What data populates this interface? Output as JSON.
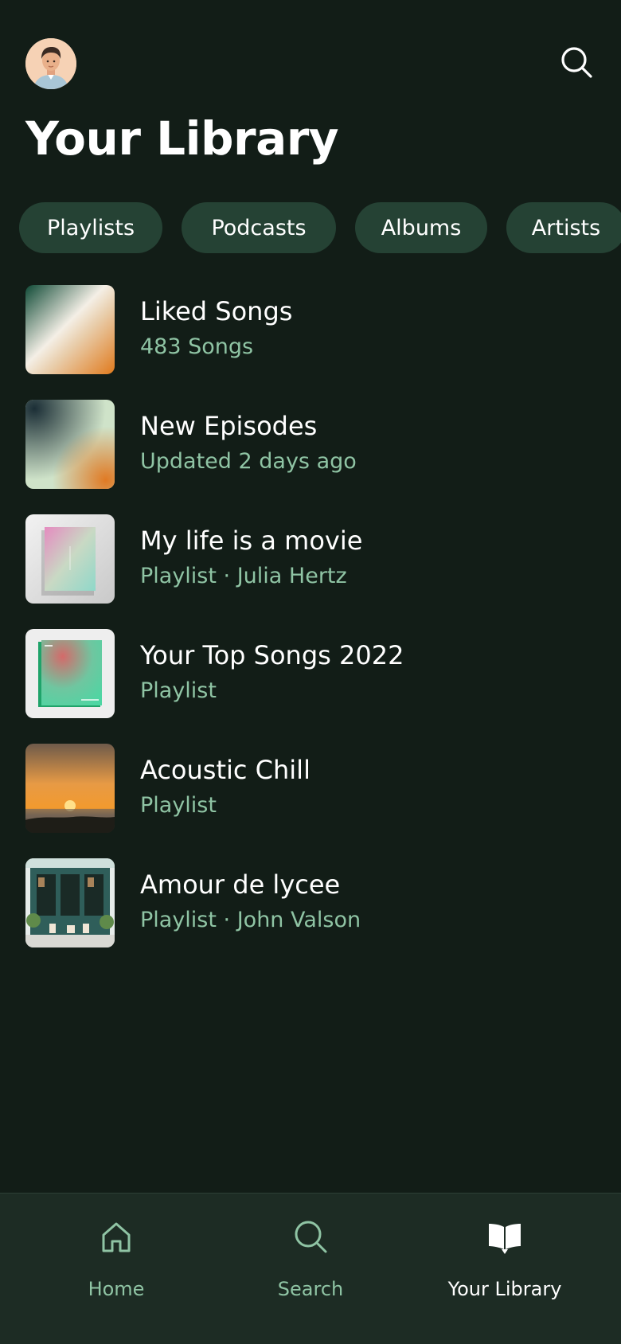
{
  "header": {
    "title": "Your Library",
    "avatar_icon": "user-avatar",
    "search_icon": "search-icon"
  },
  "filters": [
    {
      "label": "Playlists"
    },
    {
      "label": "Podcasts"
    },
    {
      "label": "Albums"
    },
    {
      "label": "Artists"
    }
  ],
  "library": [
    {
      "title": "Liked Songs",
      "subtitle": "483 Songs"
    },
    {
      "title": "New Episodes",
      "subtitle": "Updated 2 days ago"
    },
    {
      "title": "My life is a movie",
      "subtitle": "Playlist · Julia Hertz"
    },
    {
      "title": "Your Top Songs 2022",
      "subtitle": "Playlist"
    },
    {
      "title": "Acoustic Chill",
      "subtitle": "Playlist"
    },
    {
      "title": "Amour de lycee",
      "subtitle": "Playlist · John Valson"
    }
  ],
  "nav": {
    "items": [
      {
        "label": "Home",
        "icon": "home-icon"
      },
      {
        "label": "Search",
        "icon": "search-icon"
      },
      {
        "label": "Your Library",
        "icon": "library-icon",
        "active": true
      }
    ]
  },
  "colors": {
    "background": "#121d17",
    "chip": "#254234",
    "subtitle": "#8fc4a4",
    "nav_background": "#1d2c24"
  }
}
